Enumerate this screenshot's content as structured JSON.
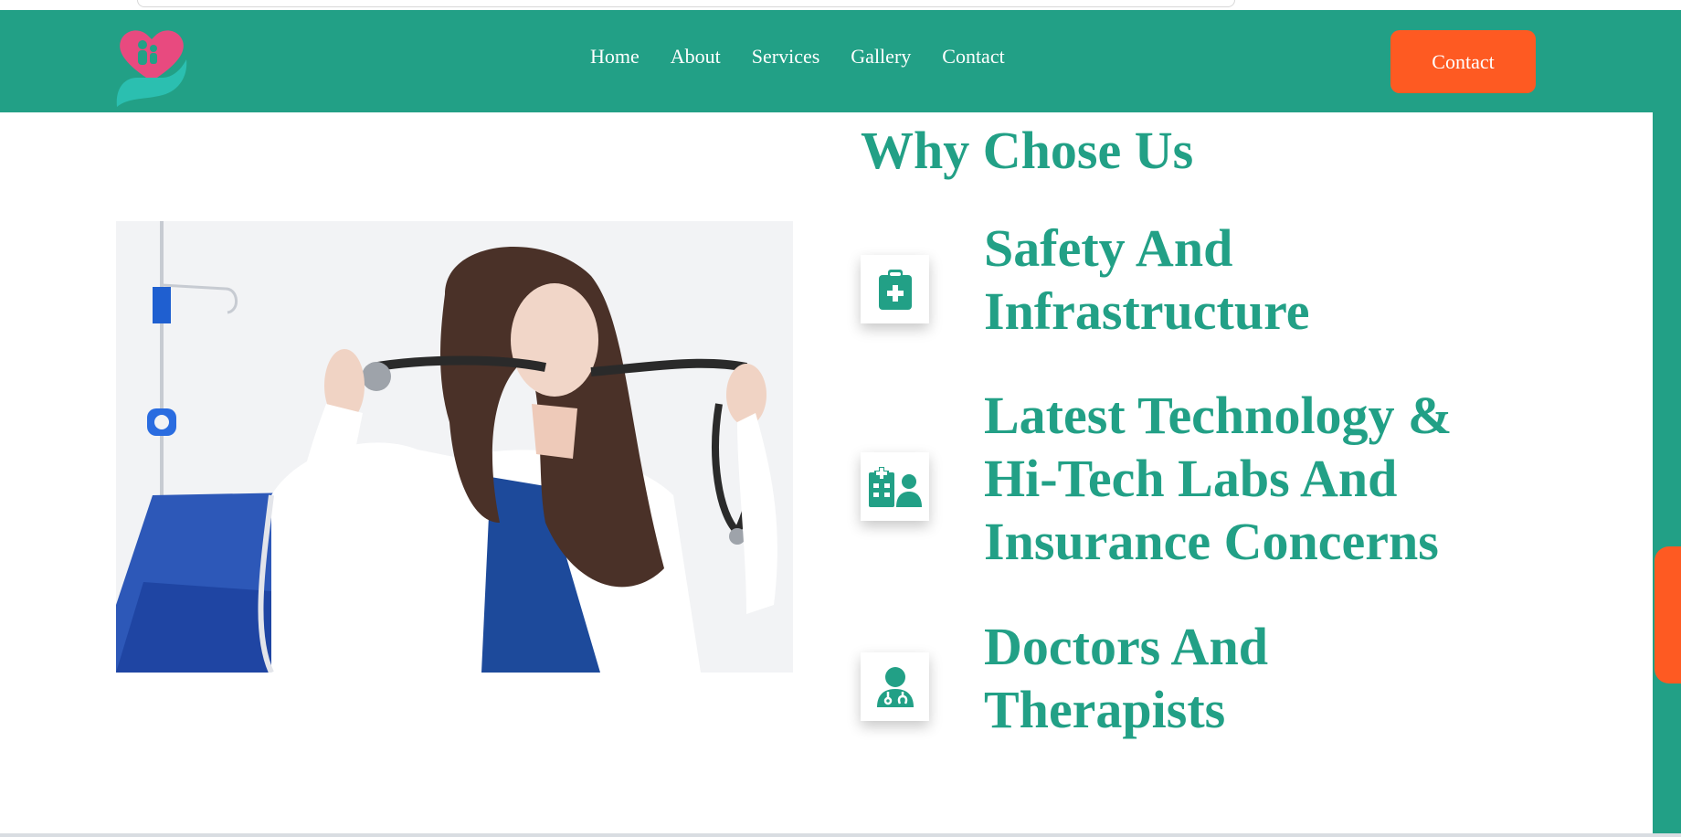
{
  "nav": {
    "logo_icon": "heart-hand-family-logo",
    "links": [
      "Home",
      "About",
      "Services",
      "Gallery",
      "Contact"
    ],
    "contact_button": "Contact"
  },
  "main": {
    "image_alt": "Doctor with stethoscope",
    "section_title": "Why Chose Us",
    "features": [
      {
        "icon": "clipboard-medical-icon",
        "title_lines": [
          "Safety And",
          "Infrastructure"
        ]
      },
      {
        "icon": "hospital-user-icon",
        "title_lines": [
          "Latest Technology &",
          "Hi-Tech Labs And",
          "Insurance Concerns"
        ]
      },
      {
        "icon": "doctor-icon",
        "title_lines": [
          "Doctors And",
          "Therapists"
        ]
      }
    ]
  },
  "colors": {
    "brand_green": "#22a086",
    "accent_orange": "#fe5a22",
    "logo_pink": "#e84a7f",
    "logo_teal": "#2bbfb0"
  }
}
